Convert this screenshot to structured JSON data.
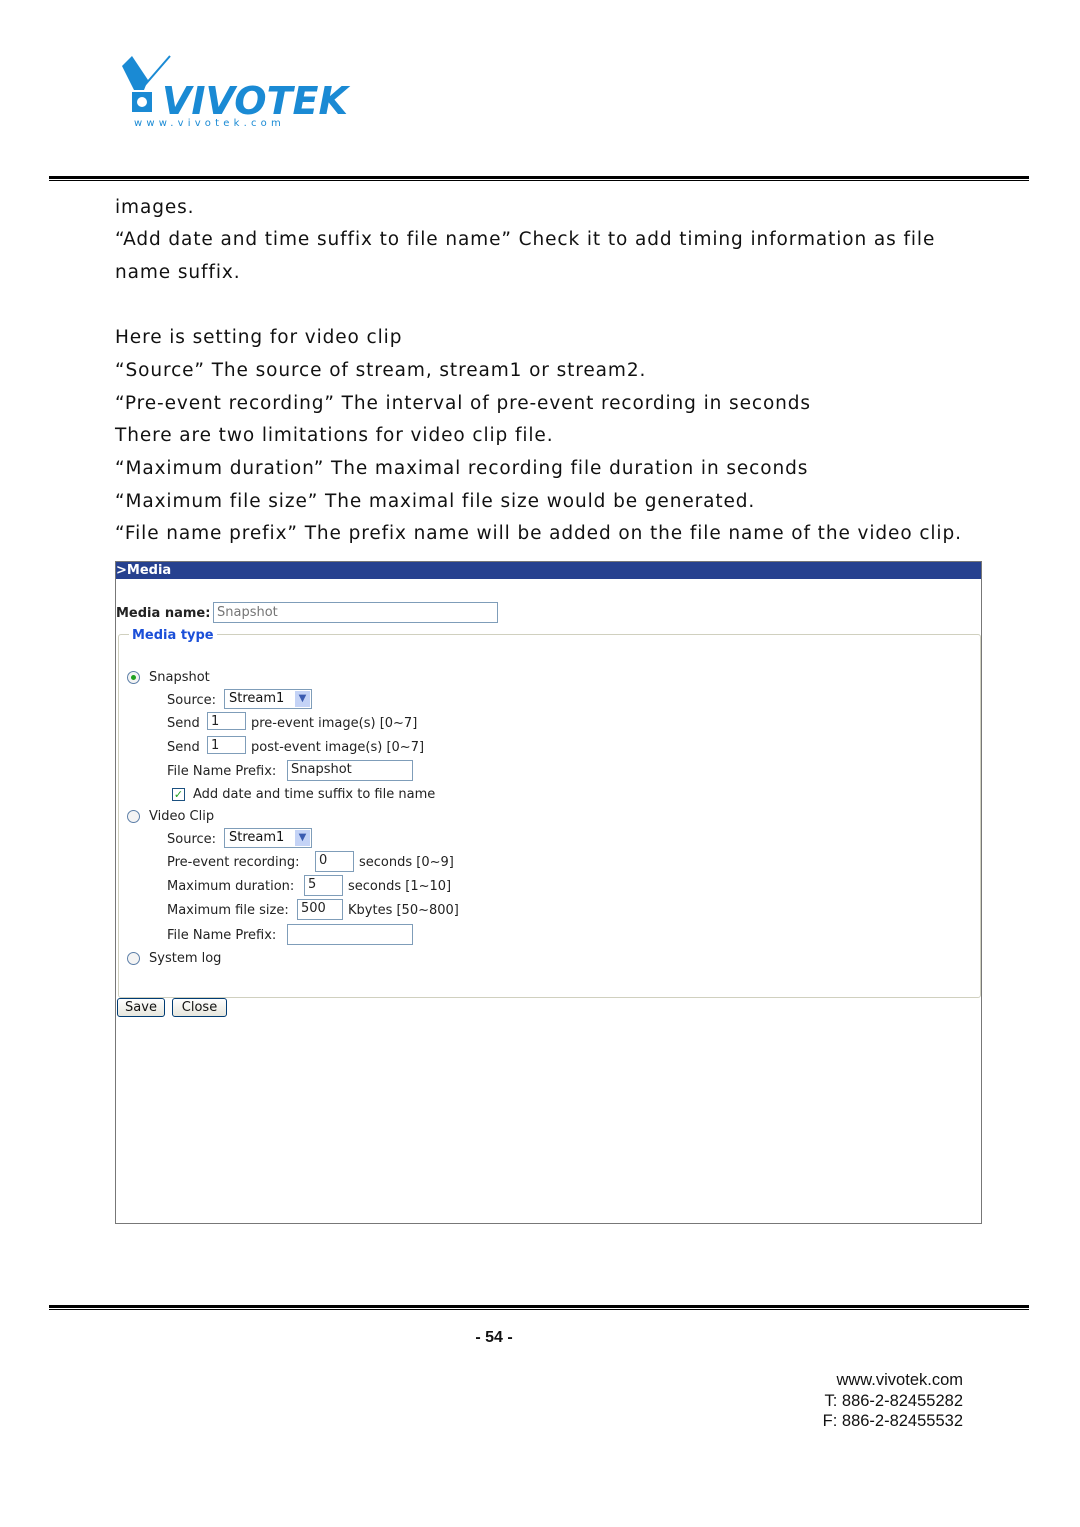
{
  "header": {
    "logo_text": "VIVOTEK",
    "logo_url_text": "www.vivotek.com",
    "brand_color": "#1a8ad4"
  },
  "body_lines": [
    "images.",
    "“Add date and time suffix to file name” Check it to add timing information as file",
    "name suffix.",
    "Here is setting for video clip",
    "“Source” The source of stream, stream1 or stream2.",
    "“Pre-event recording” The interval of pre-event recording in seconds",
    "There are two limitations for video clip file.",
    "“Maximum duration” The maximal recording file duration in seconds",
    "“Maximum file size” The maximal file size would be generated.",
    "“File name prefix” The prefix name will be added on the file name of the video clip."
  ],
  "media": {
    "title": ">Media",
    "media_name_label": "Media name:",
    "media_name_placeholder": "Snapshot",
    "media_type_legend": "Media type",
    "snapshot": {
      "label": "Snapshot",
      "selected": true,
      "source_label": "Source:",
      "source_value": "Stream1",
      "send_label": "Send",
      "pre_value": "1",
      "pre_text": "pre-event image(s) [0~7]",
      "post_value": "1",
      "post_text": "post-event image(s) [0~7]",
      "prefix_label": "File Name Prefix:",
      "prefix_value": "Snapshot",
      "suffix_label": "Add date and time suffix to file name",
      "suffix_checked": true
    },
    "video": {
      "label": "Video Clip",
      "selected": false,
      "source_label": "Source:",
      "source_value": "Stream1",
      "pre_label": "Pre-event recording:",
      "pre_value": "0",
      "pre_text": "seconds [0~9]",
      "dur_label": "Maximum duration:",
      "dur_value": "5",
      "dur_text": "seconds [1~10]",
      "size_label": "Maximum file size:",
      "size_value": "500",
      "size_text": "Kbytes [50~800]",
      "prefix_label": "File Name Prefix:",
      "prefix_value": ""
    },
    "syslog": {
      "label": "System log",
      "selected": false
    },
    "save_label": "Save",
    "close_label": "Close"
  },
  "footer": {
    "page": "- 54 -",
    "web": "www.vivotek.com",
    "tel": "T: 886-2-82455282",
    "fax": "F: 886-2-82455532"
  }
}
